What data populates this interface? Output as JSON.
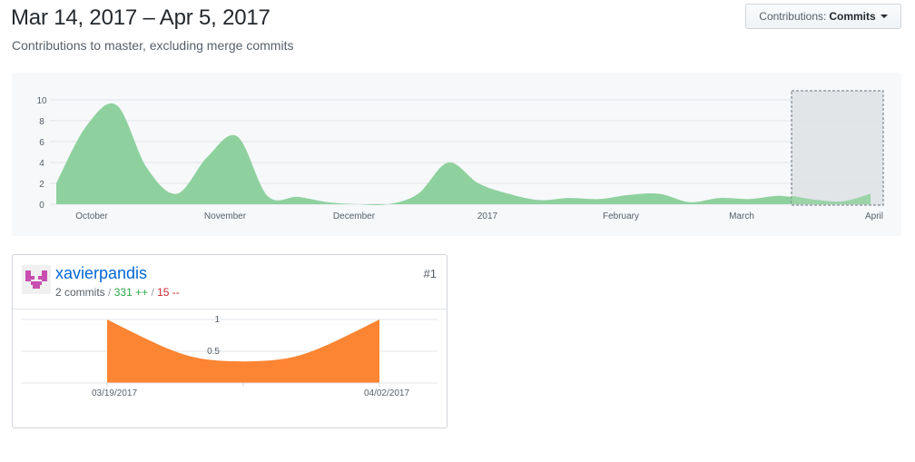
{
  "header": {
    "date_range": "Mar 14, 2017 – Apr 5, 2017",
    "subtitle": "Contributions to master, excluding merge commits"
  },
  "dropdown": {
    "label": "Contributions:",
    "value": "Commits"
  },
  "colors": {
    "main_area": "#8fd19e",
    "contributor_area": "#fb8532",
    "selection": "#dfe2e5",
    "link": "#0366d6",
    "additions": "#28a745",
    "deletions": "#cb2431"
  },
  "contributor": {
    "username": "xavierpandis",
    "commits": "2 commits",
    "additions": "331 ++",
    "deletions": "15 --",
    "separator": "/",
    "rank": "#1"
  },
  "chart_data": [
    {
      "type": "area",
      "x": [
        "Sep 24",
        "Oct 1",
        "Oct 8",
        "Oct 15",
        "Oct 22",
        "Oct 29",
        "Nov 5",
        "Nov 12",
        "Nov 19",
        "Nov 26",
        "Dec 3",
        "Dec 10",
        "Dec 17",
        "Dec 24",
        "Dec 31",
        "Jan 7",
        "Jan 14",
        "Jan 21",
        "Jan 28",
        "Feb 4",
        "Feb 11",
        "Feb 18",
        "Feb 25",
        "Mar 4",
        "Mar 11",
        "Mar 18",
        "Mar 25",
        "Apr 1"
      ],
      "values": [
        2,
        7.5,
        9.5,
        3.5,
        1,
        4.5,
        6.5,
        0.8,
        0.7,
        0.2,
        0,
        0,
        1,
        4,
        2,
        1,
        0.4,
        0.6,
        0.5,
        0.9,
        1,
        0.2,
        0.6,
        0.5,
        0.8,
        0.4,
        0.3,
        1
      ],
      "y_ticks": [
        "0",
        "2",
        "4",
        "6",
        "8",
        "10"
      ],
      "ylim": [
        0,
        10
      ],
      "x_tick_labels": [
        "October",
        "November",
        "December",
        "2017",
        "February",
        "March",
        "April"
      ],
      "selection": {
        "from": "Mar 14",
        "to": "Apr 5"
      },
      "grid": true
    },
    {
      "type": "area",
      "x": [
        "03/19/2017",
        "04/02/2017"
      ],
      "values": [
        1,
        1
      ],
      "y_ticks": [
        "0.5",
        "1"
      ],
      "ylim": [
        0,
        1
      ],
      "x_tick_labels": [
        "03/19/2017",
        "04/02/2017"
      ],
      "grid": true
    }
  ]
}
